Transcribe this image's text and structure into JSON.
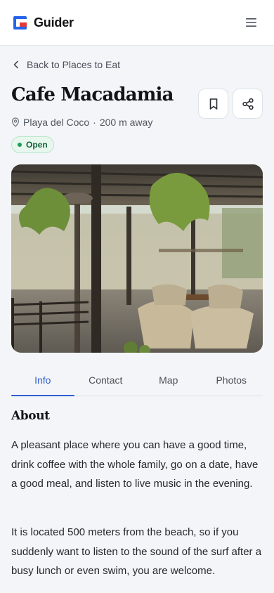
{
  "header": {
    "brand": "Guider",
    "logo_icon": "guider-logo-icon",
    "menu_icon": "hamburger-menu-icon"
  },
  "nav": {
    "back_label": "Back to Places to Eat"
  },
  "place": {
    "name": "Cafe Macadamia",
    "location": "Playa del Coco",
    "separator": "·",
    "distance": "200 m away",
    "status": "Open",
    "image_alt": "Cafe Macadamia terrace with hanging ferns and wicker chairs"
  },
  "actions": {
    "bookmark_icon": "bookmark-icon",
    "share_icon": "share-icon"
  },
  "tabs": [
    {
      "label": "Info",
      "active": true
    },
    {
      "label": "Contact",
      "active": false
    },
    {
      "label": "Map",
      "active": false
    },
    {
      "label": "Photos",
      "active": false
    }
  ],
  "about": {
    "heading": "About",
    "paragraphs": [
      "A pleasant place where you can have a good time, drink coffee with the whole family, go on a date, have a good meal, and listen to live music in the evening.",
      "It is located 500 meters from the beach, so if you suddenly want to listen to the sound of the surf after a busy lunch or even swim, you are welcome."
    ]
  },
  "colors": {
    "accent": "#2f5fd0",
    "logo_blue": "#2563eb",
    "logo_red": "#e53935",
    "open_green": "#1e9e55",
    "background": "#f3f5f8"
  }
}
